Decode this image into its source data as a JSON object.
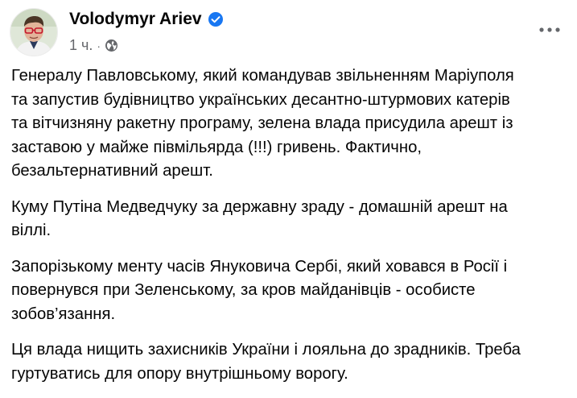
{
  "post": {
    "author": "Volodymyr Ariev",
    "time": "1 ч.",
    "separator": "·",
    "audience_icon": "globe-icon",
    "verified_icon": "verified-badge-icon",
    "more_icon": "more-options-icon",
    "paragraphs": [
      "Генералу Павловському, який командував звільненням Маріуполя\nта запустив будівництво українських десантно-штурмових катерів\nта вітчизняну ракетну програму, зелена влада присудила арешт із\nзаставою у майже півмільярда (!!!) гривень. Фактично,\nбезальтернативний арешт.",
      "Куму Путіна Медведчуку за державну зраду - домашній арешт на\nвіллі.",
      "Запорізькому менту часів Януковича Сербі, який ховався в Росії і\nповернувся при Зеленському, за кров майданівців - особисте\nзобов’язання.",
      "Ця влада нищить захисників України і лояльна до зрадників. Треба\nгуртуватись для опору внутрішньому ворогу."
    ]
  },
  "colors": {
    "verified": "#1877f2",
    "secondary_text": "#65676b",
    "text": "#050505"
  }
}
